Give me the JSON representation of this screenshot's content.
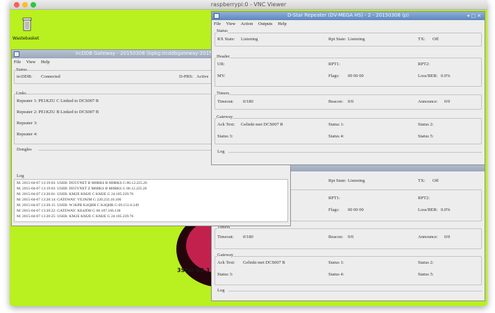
{
  "mac_window": {
    "title": "raspberrypi:0 - VNC Viewer"
  },
  "desktop": {
    "wastebasket_label": "Wastebasket",
    "background_label": "3Star V2.1",
    "colors": {
      "background": "#b9f01f",
      "accent": "#c2214e"
    }
  },
  "gateway": {
    "title": "ircDDB Gateway - 20150308 (bpkg:ircddbgateway-20150308)",
    "menu": [
      "File",
      "View",
      "Help"
    ],
    "status": {
      "group_label": "Status",
      "ircddb_label": "ircDDB:",
      "ircddb_value": "Connected",
      "dprs_label": "D-PRS:",
      "dprs_value": "Active"
    },
    "links": {
      "group_label": "Links",
      "repeaters": [
        "Repeater 1:  PE1KZU C  Linked to  DCS007 R",
        "Repeater 2:  PE1KZU B  Linked to  DCS007 B",
        "Repeater 3:",
        "Repeater 4:"
      ]
    },
    "dongles_label": "Dongles",
    "log": {
      "label": "Log",
      "lines": [
        "M: 2015-04-07 13:19:03: USER: DO5YNET B  M0BKS  B M0BKS  G 86.12.225.26",
        "M: 2015-04-07 13:19:03: USER: DO5YNET Z  M0BKS  B M0BKS  G 86.12.225.26",
        "M: 2015-04-07 13:20:01: USER: KM2E     KM2E   C KM2E   G 24.105.239.76",
        "M: 2015-04-07 13:20:14: GATEWAY: VE3NJM G 220.233.10.100",
        "M: 2015-04-07 13:20:15: USER: W1KPR    K4QHR  C K4QHR  G 69.151.0.249",
        "M: 2015-04-07 13:20:22: GATEWAY: KE4JDH G 66.187.166.138",
        "M: 2015-04-07 13:20:25: USER: KM2E     KM2E   C KM2E   G 24.105.239.76"
      ]
    }
  },
  "repeater_front": {
    "title": "D-Star Repeater (DV-MEGA HS) - 2 - 20150308 (p)",
    "menu": [
      "File",
      "View",
      "Action",
      "Outputs",
      "Help"
    ],
    "status": {
      "group_label": "Status",
      "rx_label": "RX State:",
      "rx_value": "Listening",
      "rpt_label": "Rpt State:",
      "rpt_value": "Listening",
      "tx_label": "TX:",
      "tx_value": "Off"
    },
    "header": {
      "group_label": "Header",
      "ur_label": "UR:",
      "my_label": "MY:",
      "rpt1_label": "RPT1:",
      "rpt2_label": "RPT2:",
      "flags_label": "Flags:",
      "flags_value": "00 00 00",
      "loss_label": "Loss/BER:",
      "loss_value": "0.0%"
    },
    "timers": {
      "group_label": "Timers",
      "timeout_label": "Timeout:",
      "timeout_value": "0/180",
      "beacon_label": "Beacon:",
      "beacon_value": "0/0",
      "announce_label": "Announce:",
      "announce_value": "0/0"
    },
    "gateway": {
      "group_label": "Gateway",
      "ack_label": "Ack Text:",
      "ack_value": "Gelinkt met DCS007 R",
      "s1": "Status 1:",
      "s2": "Status 2:",
      "s3": "Status 3:",
      "s4": "Status 4:",
      "s5": "Status 5:"
    },
    "log_label": "Log"
  },
  "repeater_back": {
    "status": {
      "rpt_label": "Rpt State:",
      "rpt_value": "Listening",
      "tx_label": "TX:",
      "tx_value": "Off"
    },
    "header": {
      "rpt1_label": "RPT1:",
      "rpt2_label": "RPT2:",
      "flags_label": "Flags:",
      "flags_value": "00 00 00",
      "loss_label": "Loss/BER:",
      "loss_value": "0.0%"
    },
    "timers": {
      "group_label": "Timers",
      "timeout_label": "Timeout:",
      "timeout_value": "0/180",
      "beacon_label": "Beacon:",
      "beacon_value": "0/0",
      "announce_label": "Announce:",
      "announce_value": "0/0"
    },
    "gateway": {
      "group_label": "Gateway",
      "ack_label": "Ack Text:",
      "ack_value": "Gelinkt met DCS007 R",
      "s1": "Status 1:",
      "s2": "Status 2:",
      "s3": "Status 3:",
      "s4": "Status 4:",
      "s5": "Status 5:"
    },
    "log_label": "Log"
  }
}
